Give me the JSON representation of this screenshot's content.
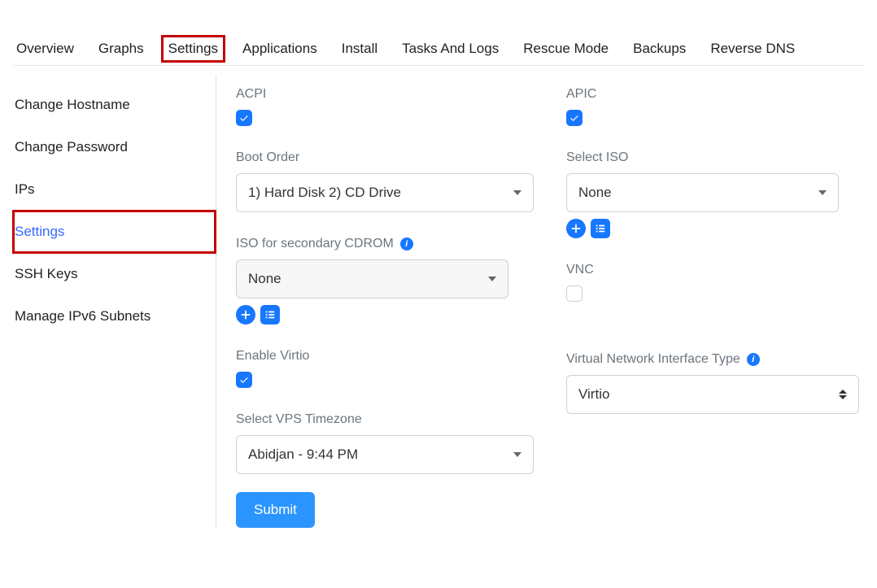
{
  "tabs": {
    "overview": "Overview",
    "graphs": "Graphs",
    "settings": "Settings",
    "applications": "Applications",
    "install": "Install",
    "tasks": "Tasks And Logs",
    "rescue": "Rescue Mode",
    "backups": "Backups",
    "rdns": "Reverse DNS"
  },
  "sidebar": {
    "hostname": "Change Hostname",
    "password": "Change Password",
    "ips": "IPs",
    "settings": "Settings",
    "sshkeys": "SSH Keys",
    "ipv6": "Manage IPv6 Subnets"
  },
  "labels": {
    "acpi": "ACPI",
    "apic": "APIC",
    "boot_order": "Boot Order",
    "select_iso": "Select ISO",
    "iso_secondary": "ISO for secondary CDROM",
    "vnc": "VNC",
    "enable_virtio": "Enable Virtio",
    "vnif_type": "Virtual Network Interface Type",
    "timezone": "Select VPS Timezone",
    "submit": "Submit"
  },
  "values": {
    "boot_order": "1) Hard Disk 2) CD Drive",
    "select_iso": "None",
    "iso_secondary": "None",
    "vnif_type": "Virtio",
    "timezone": "Abidjan - 9:44 PM"
  },
  "checks": {
    "acpi": true,
    "apic": true,
    "vnc": false,
    "enable_virtio": true
  }
}
